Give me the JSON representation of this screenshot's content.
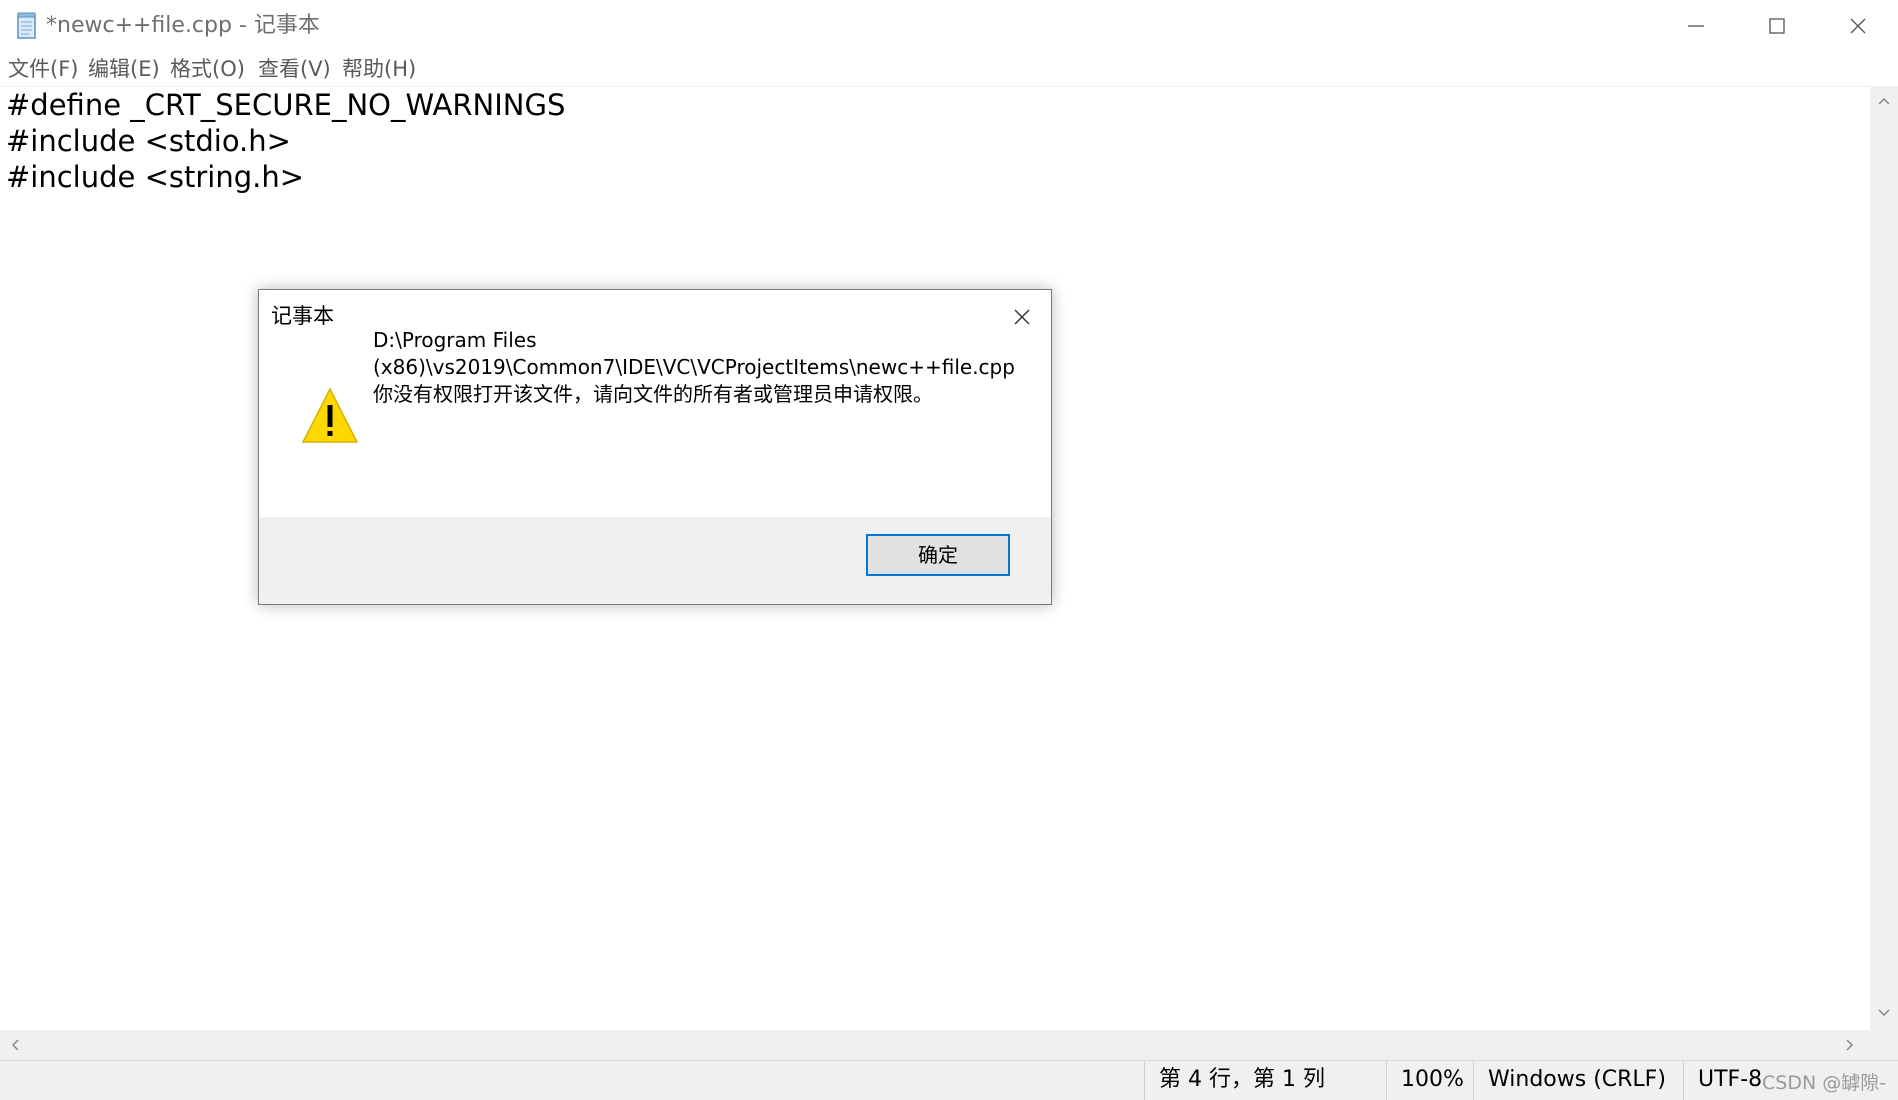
{
  "window": {
    "title": "*newc++file.cpp - 记事本",
    "icon": "notepad-icon",
    "controls": {
      "minimize": "minimize-icon",
      "maximize": "maximize-icon",
      "close": "close-icon"
    }
  },
  "menu": {
    "items": [
      {
        "label": "文件(F)"
      },
      {
        "label": "编辑(E)"
      },
      {
        "label": "格式(O)"
      },
      {
        "label": "查看(V)"
      },
      {
        "label": "帮助(H)"
      }
    ]
  },
  "editor": {
    "lines": [
      "#define _CRT_SECURE_NO_WARNINGS",
      "#include <stdio.h>",
      "#include <string.h>"
    ]
  },
  "status": {
    "position": "第 4 行，第 1 列",
    "zoom": "100%",
    "line_ending": "Windows (CRLF)",
    "encoding": "UTF-8"
  },
  "watermark": "CSDN @罅隙-",
  "dialog": {
    "title": "记事本",
    "icon": "warning-icon",
    "message_lines": [
      "D:\\Program Files",
      "(x86)\\vs2019\\Common7\\IDE\\VC\\VCProjectItems\\newc++file.cpp",
      "你没有权限打开该文件，请向文件的所有者或管理员申请权限。"
    ],
    "ok_label": "确定"
  },
  "colors": {
    "accent": "#0078d7",
    "warning": "#ffd800",
    "chrome": "#f0f0f0"
  }
}
